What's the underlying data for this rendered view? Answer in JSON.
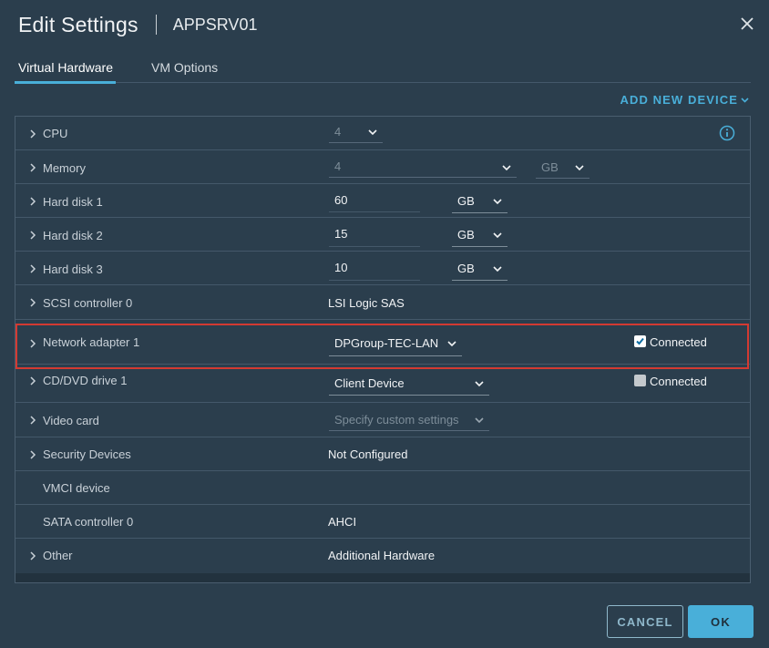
{
  "dialog": {
    "title": "Edit Settings",
    "vm_name": "APPSRV01",
    "close_icon": "close-icon"
  },
  "tabs": [
    {
      "label": "Virtual Hardware",
      "active": true
    },
    {
      "label": "VM Options",
      "active": false
    }
  ],
  "add_new_device": "ADD NEW DEVICE",
  "hardware": {
    "cpu": {
      "label": "CPU",
      "value": "4"
    },
    "memory": {
      "label": "Memory",
      "value": "4",
      "unit": "GB"
    },
    "hard_disk_1": {
      "label": "Hard disk 1",
      "value": "60",
      "unit": "GB"
    },
    "hard_disk_2": {
      "label": "Hard disk 2",
      "value": "15",
      "unit": "GB"
    },
    "hard_disk_3": {
      "label": "Hard disk 3",
      "value": "10",
      "unit": "GB"
    },
    "scsi": {
      "label": "SCSI controller 0",
      "value": "LSI Logic SAS"
    },
    "network": {
      "label": "Network adapter 1",
      "value": "DPGroup-TEC-LAN",
      "connected_label": "Connected",
      "connected": true
    },
    "cdrom": {
      "label": "CD/DVD drive 1",
      "value": "Client Device",
      "connected_label": "Connected",
      "connected": false
    },
    "video": {
      "label": "Video card",
      "value": "Specify custom settings"
    },
    "security": {
      "label": "Security Devices",
      "value": "Not Configured"
    },
    "vmci": {
      "label": "VMCI device"
    },
    "sata": {
      "label": "SATA controller 0",
      "value": "AHCI"
    },
    "other": {
      "label": "Other",
      "value": "Additional Hardware"
    }
  },
  "buttons": {
    "cancel": "CANCEL",
    "ok": "OK"
  },
  "colors": {
    "accent": "#49afd9",
    "background": "#2b3e4d",
    "highlight": "#d33a32"
  }
}
